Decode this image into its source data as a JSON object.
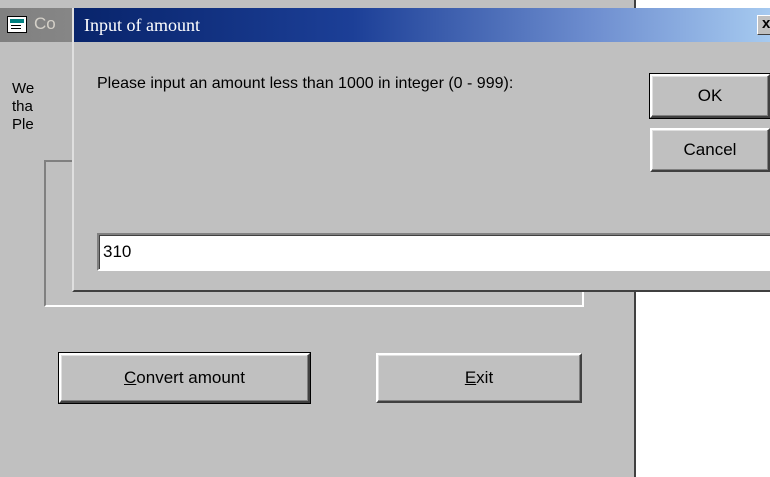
{
  "main_window": {
    "title_fragment": "Co",
    "message_fragment": "We\ntha\nPle",
    "convert_button": {
      "mnemonic": "C",
      "rest": "onvert amount"
    },
    "exit_button": {
      "mnemonic": "E",
      "rest": "xit"
    },
    "icon": "app-window-icon"
  },
  "dialog": {
    "title": "Input of amount",
    "close_label": "x",
    "prompt": "Please input an amount less than 1000 in integer (0 - 999):",
    "ok_label": "OK",
    "cancel_label": "Cancel",
    "input_value": "310"
  },
  "colors": {
    "dialog_title_start": "#08246b",
    "dialog_title_end": "#a6caf0",
    "window_face": "#c0c0c0"
  }
}
